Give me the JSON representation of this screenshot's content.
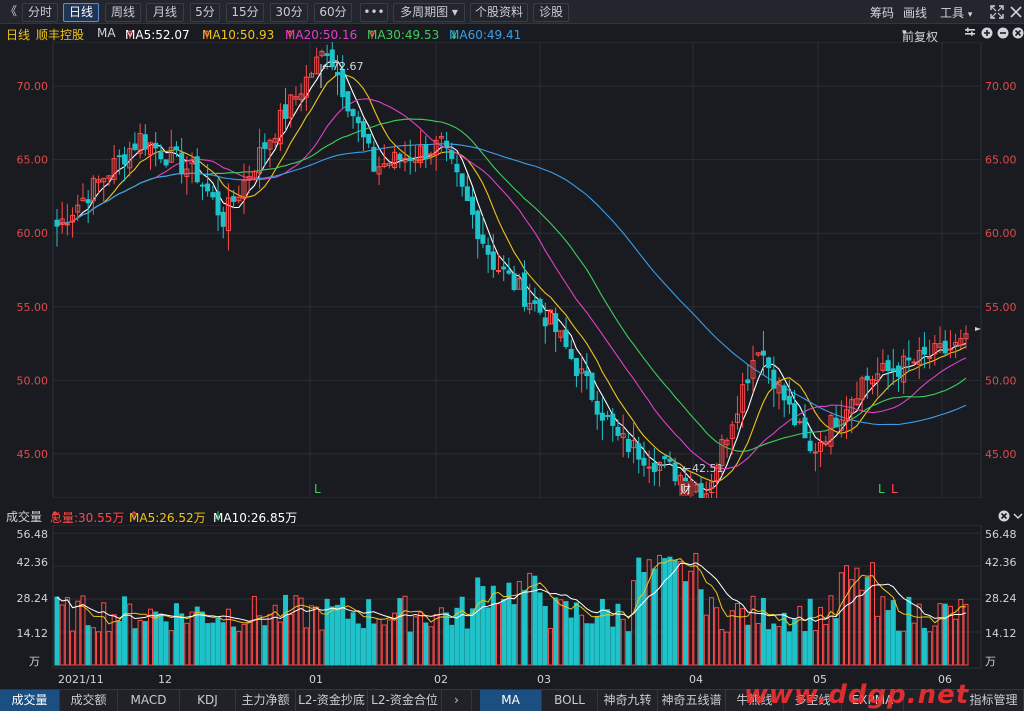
{
  "toolbar": {
    "back_glyph": "《",
    "periods": [
      "分时",
      "日线",
      "周线",
      "月线",
      "5分",
      "15分",
      "30分",
      "60分"
    ],
    "active_period": "日线",
    "more_glyph": "•••",
    "multi_period": "多周期图",
    "stock_info": "个股资料",
    "diagnose": "诊股",
    "right": [
      "筹码",
      "画线",
      "工具"
    ]
  },
  "legend": {
    "period": "日线",
    "stock_name": "顺丰控股",
    "ma_label": "MA",
    "ma5": "MA5:52.07",
    "ma10": "MA10:50.93",
    "ma20": "MA20:50.16",
    "ma30": "MA30:49.53",
    "ma60": "MA60:49.41",
    "ma5_dir": "↑",
    "ma10_dir": "↑",
    "ma20_dir": "↑",
    "ma30_dir": "↑",
    "ma60_dir": "↓",
    "adjust": "前复权"
  },
  "price_axis": {
    "ticks": [
      "70.00",
      "65.00",
      "60.00",
      "55.00",
      "50.00",
      "45.00"
    ],
    "high_label": "72.67",
    "low_label": "42.51"
  },
  "markers": {
    "L": "L",
    "cai": "财"
  },
  "volume": {
    "title": "成交量",
    "total": "总量:30.55万",
    "total_dir": "↑",
    "ma5": "MA5:26.52万",
    "ma5_dir": "↑",
    "ma10": "MA10:26.85万",
    "ma10_dir": "↓",
    "ticks": [
      "56.48",
      "42.36",
      "28.24",
      "14.12"
    ],
    "unit": "万"
  },
  "x_axis": {
    "labels": [
      "2021/11",
      "12",
      "01",
      "02",
      "03",
      "04",
      "05",
      "06"
    ]
  },
  "bottom_tabs_left": [
    "成交量",
    "成交额",
    "MACD",
    "KDJ",
    "主力净额",
    "L2-资金抄底",
    "L2-资金合位"
  ],
  "bottom_tabs_right": [
    "MA",
    "BOLL",
    "神奇九转",
    "神奇五线谱",
    "牛熊线",
    "多空线",
    "EXPMA",
    "指标管理"
  ],
  "watermark": "www.ddgp.net",
  "colors": {
    "up": "#ff4a4a",
    "down": "#1fc2c9",
    "ma5": "#ffffff",
    "ma10": "#f0c419",
    "ma20": "#e040c8",
    "ma30": "#3ccf5a",
    "ma60": "#3a9ee8"
  },
  "chart_data": {
    "type": "candlestick",
    "title": "顺丰控股",
    "y_range": [
      42.0,
      73.0
    ],
    "key_points": [
      {
        "x": "2021/11",
        "y": 60.5
      },
      {
        "x": "2021/11",
        "y": 66.5
      },
      {
        "x": "12",
        "y": 64.0
      },
      {
        "x": "12",
        "y": 61.0
      },
      {
        "x": "12",
        "y": 66.0
      },
      {
        "x": "01",
        "y": 72.67
      },
      {
        "x": "01",
        "y": 64.5
      },
      {
        "x": "02",
        "y": 66.0
      },
      {
        "x": "02",
        "y": 58.0
      },
      {
        "x": "03",
        "y": 54.0
      },
      {
        "x": "03",
        "y": 46.0
      },
      {
        "x": "04",
        "y": 42.51
      },
      {
        "x": "04",
        "y": 52.5
      },
      {
        "x": "05",
        "y": 45.0
      },
      {
        "x": "05",
        "y": 50.0
      },
      {
        "x": "06",
        "y": 52.5
      }
    ],
    "volume_range": [
      0,
      60
    ]
  }
}
